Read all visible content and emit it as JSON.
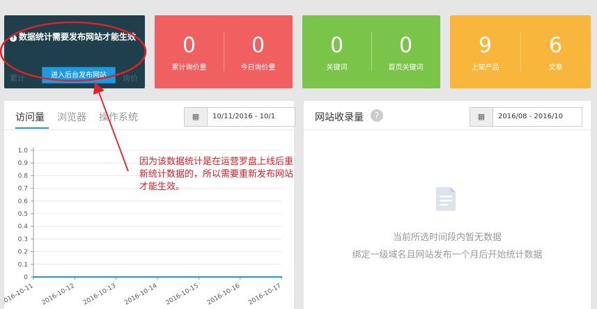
{
  "notice": {
    "message": "数据统计需要发布网站才能生效",
    "button_label": "进入后台发布网站",
    "ghost_left": "累计",
    "ghost_right": "询价"
  },
  "stat_cards": [
    {
      "color": "#f06061",
      "items": [
        {
          "value": "0",
          "label": "累计询价量"
        },
        {
          "value": "0",
          "label": "今日询价量"
        }
      ]
    },
    {
      "color": "#7bc44a",
      "items": [
        {
          "value": "0",
          "label": "关键词"
        },
        {
          "value": "0",
          "label": "首页关键词"
        }
      ]
    },
    {
      "color": "#f8b73c",
      "items": [
        {
          "value": "9",
          "label": "上架产品"
        },
        {
          "value": "6",
          "label": "文章"
        }
      ]
    }
  ],
  "traffic_panel": {
    "tabs": [
      {
        "label": "访问量",
        "active": true
      },
      {
        "label": "浏览器",
        "active": false
      },
      {
        "label": "操作系统",
        "active": false
      }
    ],
    "date_range": "10/11/2016 - 10/1",
    "calendar_icon": "calendar-icon"
  },
  "index_panel": {
    "title": "网站收录量",
    "help_icon": "?",
    "date_range": "2016/08 - 2016/10",
    "calendar_icon": "calendar-icon",
    "empty_icon": "document-icon",
    "empty_line1": "当前所选时间段内暂无数据",
    "empty_line2": "绑定一级域名且网站发布一个月后开始统计数据"
  },
  "annotation": {
    "text": "因为该数据统计是在运营罗盘上线后重新统计数据的，所以需要重新发布网站才能生效。",
    "color": "#e0202a"
  },
  "chart_data": {
    "type": "line",
    "categories": [
      "2016-10-11",
      "2016-10-12",
      "2016-10-13",
      "2016-10-14",
      "2016-10-15",
      "2016-10-16",
      "2016-10-17"
    ],
    "y_ticks": [
      "1.0",
      "0.9",
      "0.8",
      "0.7",
      "0.6",
      "0.5",
      "0.4",
      "0.3",
      "0.2",
      "0.1",
      "0"
    ],
    "series": [
      {
        "values": [
          0,
          0,
          0,
          0,
          0,
          0,
          0
        ]
      }
    ],
    "ylim": [
      0,
      1
    ],
    "line_color": "#1e9be0",
    "grid": true
  }
}
